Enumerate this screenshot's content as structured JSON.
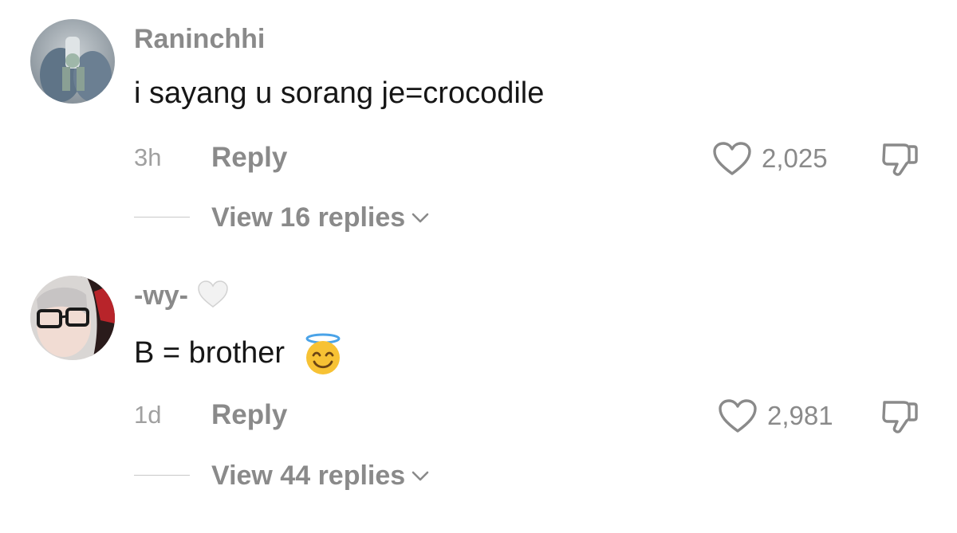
{
  "comments": [
    {
      "username": "Raninchhi",
      "text": "i sayang u sorang je=crocodile",
      "time": "3h",
      "reply_label": "Reply",
      "likes": "2,025",
      "view_replies": "View 16 replies"
    },
    {
      "username": "-wy-",
      "username_emoji": "white-heart",
      "text": "B = brother",
      "text_emoji": "smiling-face-with-halo",
      "time": "1d",
      "reply_label": "Reply",
      "likes": "2,981",
      "view_replies": "View 44 replies"
    }
  ],
  "colors": {
    "secondary_text": "#8a8a8a",
    "primary_text": "#161616",
    "divider": "#c8c8c8"
  }
}
